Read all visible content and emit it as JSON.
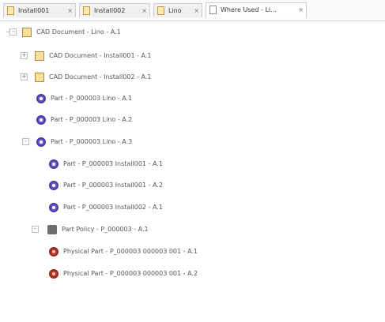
{
  "tabs": [
    {
      "label": "Install001",
      "active": false
    },
    {
      "label": "Install002",
      "active": false
    },
    {
      "label": "Lino",
      "active": false
    },
    {
      "label": "Where Used - Li...",
      "active": true
    }
  ],
  "tree": [
    {
      "label": "CAD Document - Lino - A.1",
      "icon": "cad-document-icon",
      "expander": "-"
    },
    {
      "label": "CAD Document - Install001 - A.1",
      "icon": "cad-document-icon",
      "expander": "+"
    },
    {
      "label": "CAD Document - Install002 - A.1",
      "icon": "cad-document-icon",
      "expander": "+"
    },
    {
      "label": "Part - P_000003 Lino - A.1",
      "icon": "part-icon",
      "expander": ""
    },
    {
      "label": "Part - P_000003 Lino - A.2",
      "icon": "part-icon",
      "expander": ""
    },
    {
      "label": "Part - P_000003 Lino - A.3",
      "icon": "part-icon",
      "expander": "-"
    },
    {
      "label": "Part - P_000003 Install001 - A.1",
      "icon": "part-icon",
      "expander": ""
    },
    {
      "label": "Part - P_000003 Install001 - A.2",
      "icon": "part-icon",
      "expander": ""
    },
    {
      "label": "Part - P_000003 Install002 - A.1",
      "icon": "part-icon",
      "expander": ""
    },
    {
      "label": "Part Policy - P_000003 - A.1",
      "icon": "part-policy-icon",
      "expander": "-"
    },
    {
      "label": "Physical Part - P_000003 000003 001 - A.1",
      "icon": "physical-part-icon",
      "expander": ""
    },
    {
      "label": "Physical Part - P_000003 000003 001 - A.2",
      "icon": "physical-part-icon",
      "expander": ""
    }
  ],
  "colors": {
    "part": "#6a5acd",
    "physical_part": "#c0392b",
    "cad": "#f6dfa0"
  }
}
